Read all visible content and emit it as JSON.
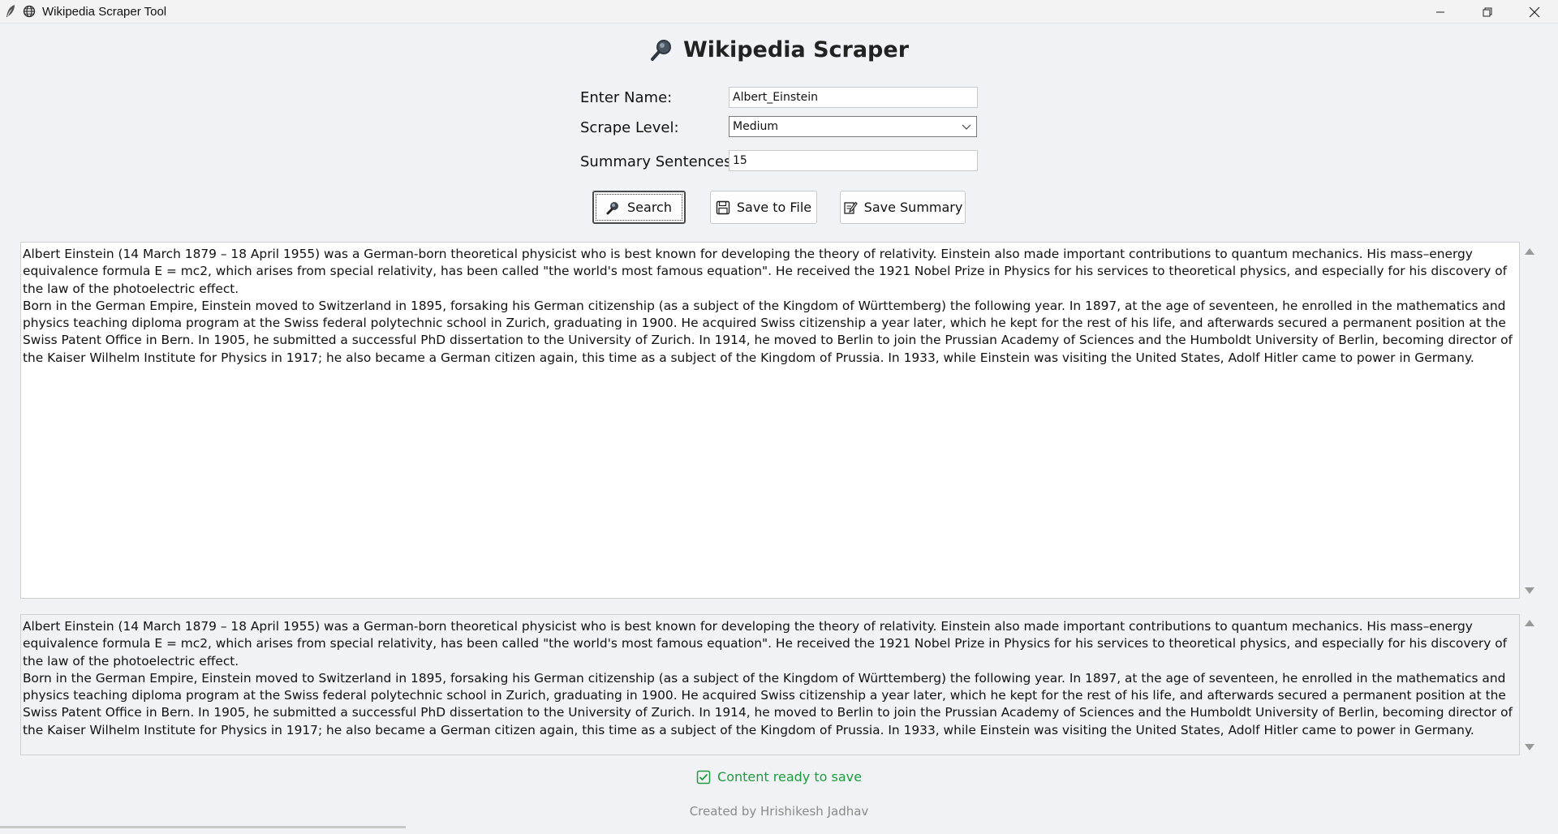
{
  "window": {
    "title": "Wikipedia Scraper Tool",
    "controls": [
      "minimize",
      "restore",
      "close"
    ]
  },
  "header": {
    "title": "Wikipedia Scraper",
    "icon": "magnifier-icon"
  },
  "form": {
    "name_label": "Enter Name:",
    "name_value": "Albert_Einstein",
    "level_label": "Scrape Level:",
    "level_value": "Medium",
    "sentences_label": "Summary Sentences:",
    "sentences_value": "15"
  },
  "buttons": {
    "search": "Search",
    "save_file": "Save to File",
    "save_summary": "Save Summary"
  },
  "content": {
    "main_text": "Albert Einstein (14 March 1879 – 18 April 1955) was a German-born theoretical physicist who is best known for developing the theory of relativity. Einstein also made important contributions to quantum mechanics. His mass–energy equivalence formula E = mc2, which arises from special relativity, has been called \"the world's most famous equation\". He received the 1921 Nobel Prize in Physics for his services to theoretical physics, and especially for his discovery of the law of the photoelectric effect.",
    "main_text_2": "Born in the German Empire, Einstein moved to Switzerland in 1895, forsaking his German citizenship (as a subject of the Kingdom of Württemberg) the following year. In 1897, at the age of seventeen, he enrolled in the mathematics and physics teaching diploma program at the Swiss federal polytechnic school in Zurich, graduating in 1900. He acquired Swiss citizenship a year later, which he kept for the rest of his life, and afterwards secured a permanent position at the Swiss Patent Office in Bern. In 1905, he submitted a successful PhD dissertation to the University of Zurich. In 1914, he moved to Berlin to join the Prussian Academy of Sciences and the Humboldt University of Berlin, becoming director of the Kaiser Wilhelm Institute for Physics in 1917; he also became a German citizen again, this time as a subject of the Kingdom of Prussia. In 1933, while Einstein was visiting the United States, Adolf Hitler came to power in Germany.",
    "summary_text": "Albert Einstein (14 March 1879 – 18 April 1955) was a German-born theoretical physicist who is best known for developing the theory of relativity. Einstein also made important contributions to quantum mechanics. His mass–energy equivalence formula E = mc2, which arises from special relativity, has been called \"the world's most famous equation\". He received the 1921 Nobel Prize in Physics for his services to theoretical physics, and especially for his discovery of the law of the photoelectric effect.",
    "summary_text_2": "Born in the German Empire, Einstein moved to Switzerland in 1895, forsaking his German citizenship (as a subject of the Kingdom of Württemberg) the following year. In 1897, at the age of seventeen, he enrolled in the mathematics and physics teaching diploma program at the Swiss federal polytechnic school in Zurich, graduating in 1900. He acquired Swiss citizenship a year later, which he kept for the rest of his life, and afterwards secured a permanent position at the Swiss Patent Office in Bern. In 1905, he submitted a successful PhD dissertation to the University of Zurich. In 1914, he moved to Berlin to join the Prussian Academy of Sciences and the Humboldt University of Berlin, becoming director of the Kaiser Wilhelm Institute for Physics in 1917; he also became a German citizen again, this time as a subject of the Kingdom of Prussia. In 1933, while Einstein was visiting the United States, Adolf Hitler came to power in Germany."
  },
  "status": {
    "text": "Content ready to save",
    "color": "#1e9c3d",
    "icon": "checkbox-check-icon"
  },
  "footer": {
    "credit": "Created by Hrishikesh Jadhav"
  }
}
